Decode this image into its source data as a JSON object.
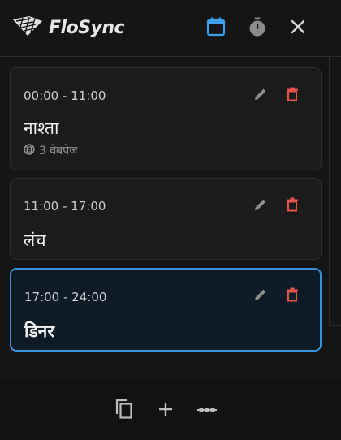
{
  "app": {
    "name": "FloSync"
  },
  "header": {
    "icons": [
      "calendar-icon",
      "timer-icon",
      "close-icon"
    ],
    "active_color": "#3a9ee8"
  },
  "schedules": [
    {
      "time": "00:00 - 11:00",
      "name": "नाश्ता",
      "meta": "3 वेबपेज",
      "selected": false
    },
    {
      "time": "11:00 - 17:00",
      "name": "लंच",
      "selected": false
    },
    {
      "time": "17:00 - 24:00",
      "name": "डिनर",
      "selected": true
    }
  ],
  "colors": {
    "accent": "#3a93d8",
    "delete": "#e5534b",
    "selected_bg": "#0e1b26"
  },
  "footer": {
    "icons": [
      "copy-icon",
      "add-icon",
      "more-icon"
    ]
  }
}
